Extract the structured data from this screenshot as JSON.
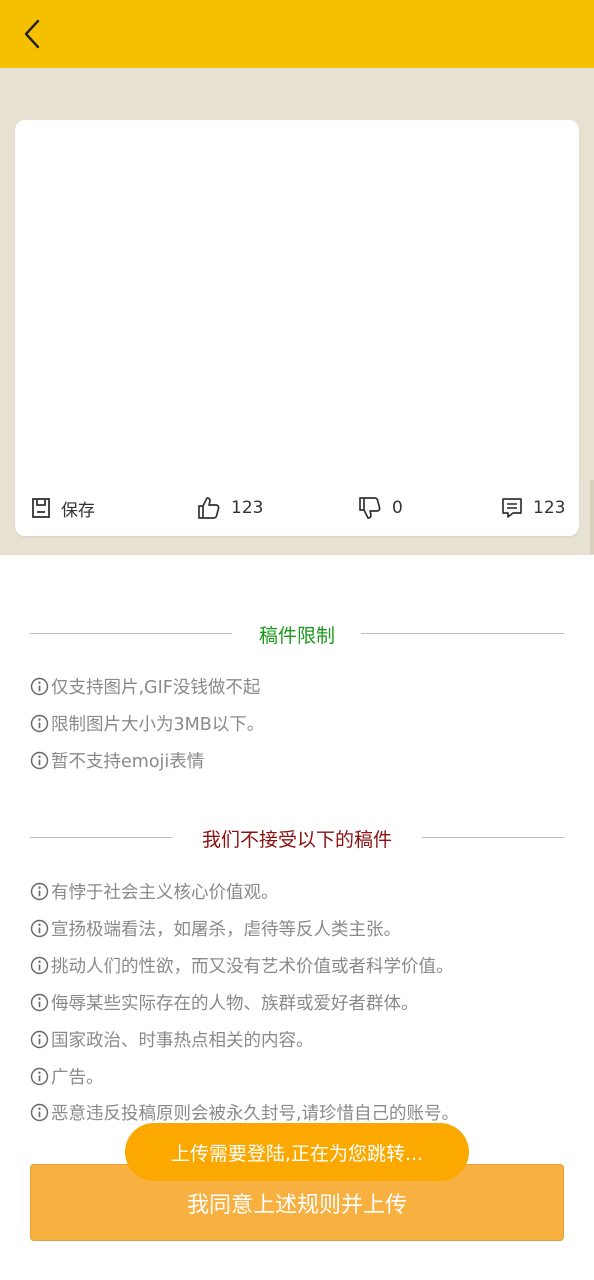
{
  "header": {
    "back_icon": "chevron-left-icon",
    "background": "#f5c000"
  },
  "card": {
    "actions": [
      {
        "icon": "save-icon",
        "label": "保存"
      },
      {
        "icon": "thumbs-up-icon",
        "label": "123"
      },
      {
        "icon": "thumbs-down-icon",
        "label": "0"
      },
      {
        "icon": "comment-icon",
        "label": "123"
      }
    ]
  },
  "limits": {
    "title": "稿件限制",
    "title_color": "#1a9a1a",
    "items": [
      "仅支持图片,GIF没钱做不起",
      "限制图片大小为3MB以下。",
      "暂不支持emoji表情"
    ]
  },
  "rejects": {
    "title": "我们不接受以下的稿件",
    "title_color": "#8b1010",
    "items": [
      "有悖于社会主义核心价值观。",
      "宣扬极端看法，如屠杀，虐待等反人类主张。",
      "挑动人们的性欲，而又没有艺术价值或者科学价值。",
      "侮辱某些实际存在的人物、族群或爱好者群体。",
      "国家政治、时事热点相关的内容。",
      "广告。",
      "恶意违反投稿原则会被永久封号,请珍惜自己的账号。"
    ]
  },
  "submit_button": {
    "label": "我同意上述规则并上传",
    "color": "#f8b040"
  },
  "toast": {
    "text": "上传需要登陆,正在为您跳转..."
  }
}
